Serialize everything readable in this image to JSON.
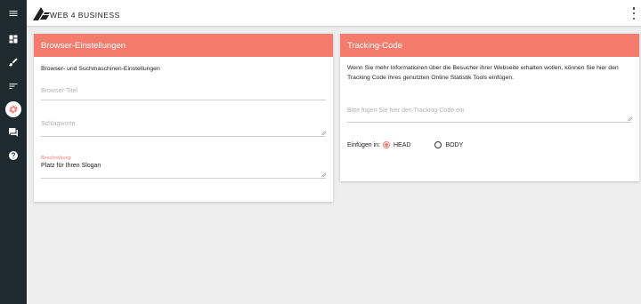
{
  "brand": {
    "name": "WEB 4 BUSINESS",
    "accent": "#f47c6e",
    "sidebar_bg": "#1f2a30"
  },
  "sidebar": {
    "items": [
      {
        "icon": "menu-icon"
      },
      {
        "icon": "dashboard-icon"
      },
      {
        "icon": "brush-icon"
      },
      {
        "icon": "sort-icon"
      },
      {
        "icon": "settings-icon",
        "active": true
      },
      {
        "icon": "chat-icon"
      },
      {
        "icon": "help-icon"
      }
    ]
  },
  "topbar": {
    "more_icon": "more-vert-icon"
  },
  "browser_card": {
    "title": "Browser-Einstellungen",
    "intro": "Browser- und Suchmaschinen-Einstellungen",
    "title_field": {
      "placeholder": "Browser-Titel"
    },
    "keywords_field": {
      "placeholder": "Schlagworte"
    },
    "description_field": {
      "label": "Beschreibung",
      "value": "Platz für Ihren Slogan"
    }
  },
  "tracking_card": {
    "title": "Tracking-Code",
    "intro": "Wenn Sie mehr Informationen über die Besucher ihrer Webseite erhalten wollen, können Sie hier den Tracking Code ihres genutzten Online Statistik Tools einfügen.",
    "code_field": {
      "placeholder": "Bitte fügen Sie hier den Tracking-Code ein"
    },
    "insert_label": "Einfügen in:",
    "options": [
      {
        "label": "HEAD",
        "selected": true
      },
      {
        "label": "BODY",
        "selected": false
      }
    ]
  }
}
